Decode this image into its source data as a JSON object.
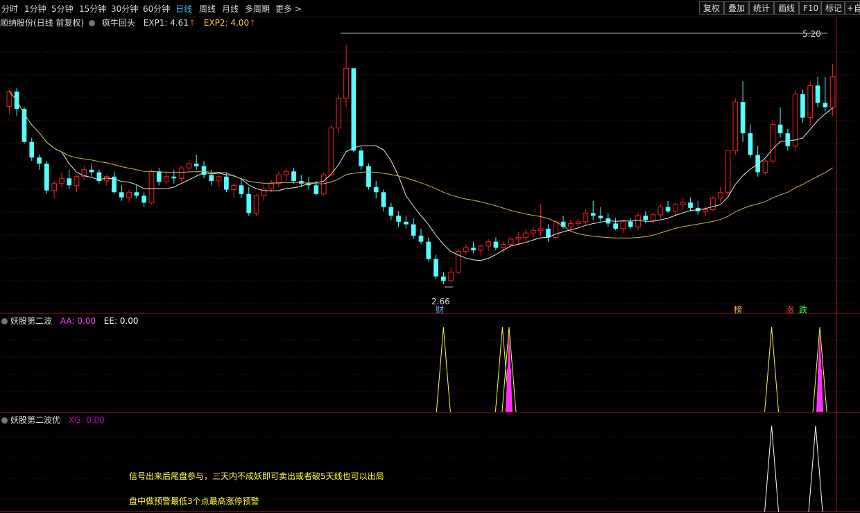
{
  "toolbar": {
    "periods": [
      "分时",
      "1分钟",
      "5分钟",
      "15分钟",
      "30分钟",
      "60分钟",
      "日线",
      "周线",
      "月线",
      "多周期",
      "更多 >"
    ],
    "buttons": [
      "复权",
      "叠加",
      "统计",
      "画线",
      "F10",
      "标记",
      "+自"
    ]
  },
  "main_chart": {
    "stock_name": "顺纳股份(日线 前复权)",
    "indicator_name": "疯牛回头",
    "exp1_label": "EXP1: 4.61",
    "exp2_label": "EXP2: 4.00",
    "arrow": "↑",
    "high_label": "5.20",
    "low_label": "2.66",
    "finance_tag": "财",
    "tags": [
      "榜",
      "涨",
      "跌"
    ],
    "colors": {
      "up": "#ff1e1e",
      "down": "#54ffff",
      "ma_fast": "#e8e8e8",
      "ma_slow": "#c8b464",
      "grid": "#7a1010"
    }
  },
  "panel1": {
    "title": "妖股第二波",
    "aa_label": "AA: 0.00",
    "ee_label": "EE: 0.00"
  },
  "panel2": {
    "title": "妖股第二波优",
    "xg_label": "XG: 0.00",
    "note_line1": "信号出来后尾盘参与，三天内不成妖即可卖出或者破5天线也可以出局",
    "note_line2": "盘中做预警最低3个点最高涨停预警"
  },
  "chart_data": {
    "type": "candlestick",
    "ohlc": [
      [
        4.71,
        4.9,
        4.62,
        4.88
      ],
      [
        4.88,
        4.92,
        4.6,
        4.68
      ],
      [
        4.68,
        4.7,
        4.28,
        4.3
      ],
      [
        4.3,
        4.35,
        4.08,
        4.12
      ],
      [
        4.12,
        4.15,
        3.98,
        4.05
      ],
      [
        4.05,
        4.08,
        3.7,
        3.74
      ],
      [
        3.74,
        3.85,
        3.65,
        3.82
      ],
      [
        3.82,
        3.95,
        3.78,
        3.88
      ],
      [
        3.88,
        3.98,
        3.76,
        3.8
      ],
      [
        3.8,
        3.92,
        3.72,
        3.9
      ],
      [
        3.9,
        4.02,
        3.86,
        3.98
      ],
      [
        3.98,
        4.05,
        3.9,
        3.95
      ],
      [
        3.95,
        3.98,
        3.82,
        3.85
      ],
      [
        3.85,
        3.92,
        3.8,
        3.9
      ],
      [
        3.9,
        3.96,
        3.7,
        3.72
      ],
      [
        3.72,
        3.8,
        3.62,
        3.66
      ],
      [
        3.66,
        3.75,
        3.6,
        3.72
      ],
      [
        3.72,
        3.8,
        3.65,
        3.68
      ],
      [
        3.68,
        3.72,
        3.55,
        3.6
      ],
      [
        3.6,
        3.98,
        3.58,
        3.96
      ],
      [
        3.96,
        4.0,
        3.8,
        3.84
      ],
      [
        3.84,
        3.95,
        3.8,
        3.9
      ],
      [
        3.9,
        3.98,
        3.82,
        3.88
      ],
      [
        3.88,
        4.02,
        3.85,
        4.0
      ],
      [
        4.0,
        4.1,
        3.96,
        4.05
      ],
      [
        4.05,
        4.15,
        3.98,
        4.02
      ],
      [
        4.02,
        4.08,
        3.88,
        3.92
      ],
      [
        3.92,
        3.98,
        3.8,
        3.85
      ],
      [
        3.85,
        3.92,
        3.78,
        3.9
      ],
      [
        3.9,
        3.95,
        3.72,
        3.75
      ],
      [
        3.75,
        3.82,
        3.66,
        3.8
      ],
      [
        3.8,
        3.88,
        3.65,
        3.7
      ],
      [
        3.7,
        3.78,
        3.45,
        3.48
      ],
      [
        3.48,
        3.7,
        3.45,
        3.68
      ],
      [
        3.68,
        3.8,
        3.62,
        3.76
      ],
      [
        3.76,
        3.86,
        3.72,
        3.82
      ],
      [
        3.82,
        3.96,
        3.78,
        3.92
      ],
      [
        3.92,
        4.0,
        3.85,
        3.96
      ],
      [
        3.96,
        4.0,
        3.82,
        3.85
      ],
      [
        3.85,
        3.92,
        3.78,
        3.82
      ],
      [
        3.82,
        3.9,
        3.75,
        3.8
      ],
      [
        3.8,
        3.85,
        3.68,
        3.7
      ],
      [
        3.7,
        3.95,
        3.68,
        3.92
      ],
      [
        3.92,
        4.5,
        3.9,
        4.46
      ],
      [
        4.46,
        4.85,
        4.4,
        4.8
      ],
      [
        4.8,
        5.42,
        4.7,
        5.15
      ],
      [
        5.15,
        5.1,
        4.18,
        4.2
      ],
      [
        4.2,
        4.25,
        3.98,
        4.02
      ],
      [
        4.02,
        4.05,
        3.75,
        3.78
      ],
      [
        3.78,
        3.85,
        3.65,
        3.72
      ],
      [
        3.72,
        3.75,
        3.5,
        3.55
      ],
      [
        3.55,
        3.6,
        3.4,
        3.45
      ],
      [
        3.45,
        3.5,
        3.32,
        3.38
      ],
      [
        3.38,
        3.45,
        3.3,
        3.35
      ],
      [
        3.35,
        3.42,
        3.18,
        3.22
      ],
      [
        3.22,
        3.3,
        3.12,
        3.15
      ],
      [
        3.15,
        3.2,
        2.92,
        2.95
      ],
      [
        2.95,
        3.0,
        2.72,
        2.75
      ],
      [
        2.75,
        2.8,
        2.66,
        2.7
      ],
      [
        2.7,
        2.85,
        2.68,
        2.8
      ],
      [
        2.8,
        3.06,
        2.78,
        3.04
      ],
      [
        3.04,
        3.12,
        3.0,
        3.08
      ],
      [
        3.08,
        3.15,
        3.02,
        3.05
      ],
      [
        3.05,
        3.12,
        2.98,
        3.1
      ],
      [
        3.1,
        3.18,
        3.04,
        3.15
      ],
      [
        3.15,
        3.2,
        3.05,
        3.08
      ],
      [
        3.08,
        3.16,
        3.02,
        3.12
      ],
      [
        3.12,
        3.2,
        3.08,
        3.18
      ],
      [
        3.18,
        3.26,
        3.12,
        3.2
      ],
      [
        3.2,
        3.3,
        3.15,
        3.25
      ],
      [
        3.25,
        3.32,
        3.2,
        3.28
      ],
      [
        3.28,
        3.58,
        3.22,
        3.3
      ],
      [
        3.3,
        3.35,
        3.15,
        3.2
      ],
      [
        3.2,
        3.4,
        3.18,
        3.38
      ],
      [
        3.38,
        3.45,
        3.3,
        3.32
      ],
      [
        3.32,
        3.4,
        3.28,
        3.36
      ],
      [
        3.36,
        3.42,
        3.3,
        3.38
      ],
      [
        3.38,
        3.52,
        3.35,
        3.48
      ],
      [
        3.48,
        3.62,
        3.4,
        3.45
      ],
      [
        3.45,
        3.55,
        3.38,
        3.42
      ],
      [
        3.42,
        3.48,
        3.32,
        3.36
      ],
      [
        3.36,
        3.42,
        3.28,
        3.3
      ],
      [
        3.3,
        3.4,
        3.25,
        3.38
      ],
      [
        3.38,
        3.42,
        3.3,
        3.32
      ],
      [
        3.32,
        3.48,
        3.28,
        3.45
      ],
      [
        3.45,
        3.5,
        3.36,
        3.4
      ],
      [
        3.4,
        3.48,
        3.35,
        3.46
      ],
      [
        3.46,
        3.58,
        3.42,
        3.55
      ],
      [
        3.55,
        3.62,
        3.48,
        3.5
      ],
      [
        3.5,
        3.6,
        3.44,
        3.58
      ],
      [
        3.58,
        3.65,
        3.52,
        3.6
      ],
      [
        3.6,
        3.66,
        3.5,
        3.54
      ],
      [
        3.54,
        3.62,
        3.46,
        3.5
      ],
      [
        3.5,
        3.56,
        3.44,
        3.52
      ],
      [
        3.52,
        3.68,
        3.5,
        3.65
      ],
      [
        3.65,
        3.78,
        3.6,
        3.72
      ],
      [
        3.72,
        3.9,
        3.68,
        4.2
      ],
      [
        4.2,
        4.8,
        4.15,
        4.76
      ],
      [
        4.76,
        5.0,
        4.3,
        4.4
      ],
      [
        4.4,
        4.5,
        4.12,
        4.15
      ],
      [
        4.15,
        4.25,
        3.9,
        3.95
      ],
      [
        3.95,
        4.1,
        3.92,
        4.08
      ],
      [
        4.08,
        4.55,
        4.05,
        4.5
      ],
      [
        4.5,
        4.7,
        4.35,
        4.4
      ],
      [
        4.4,
        4.45,
        4.2,
        4.25
      ],
      [
        4.25,
        4.9,
        4.2,
        4.85
      ],
      [
        4.85,
        4.9,
        4.52,
        4.58
      ],
      [
        4.58,
        5.0,
        4.5,
        4.95
      ],
      [
        4.95,
        5.05,
        4.7,
        4.75
      ],
      [
        4.75,
        5.05,
        4.65,
        4.7
      ],
      [
        4.7,
        5.2,
        4.6,
        5.05
      ]
    ],
    "y_range": [
      2.5,
      5.6
    ],
    "high_marker": 5.2,
    "low_marker": 2.66,
    "panel1_aa": [
      0,
      0,
      0,
      1,
      0,
      1
    ],
    "panel2_xg": [
      1,
      1
    ]
  }
}
